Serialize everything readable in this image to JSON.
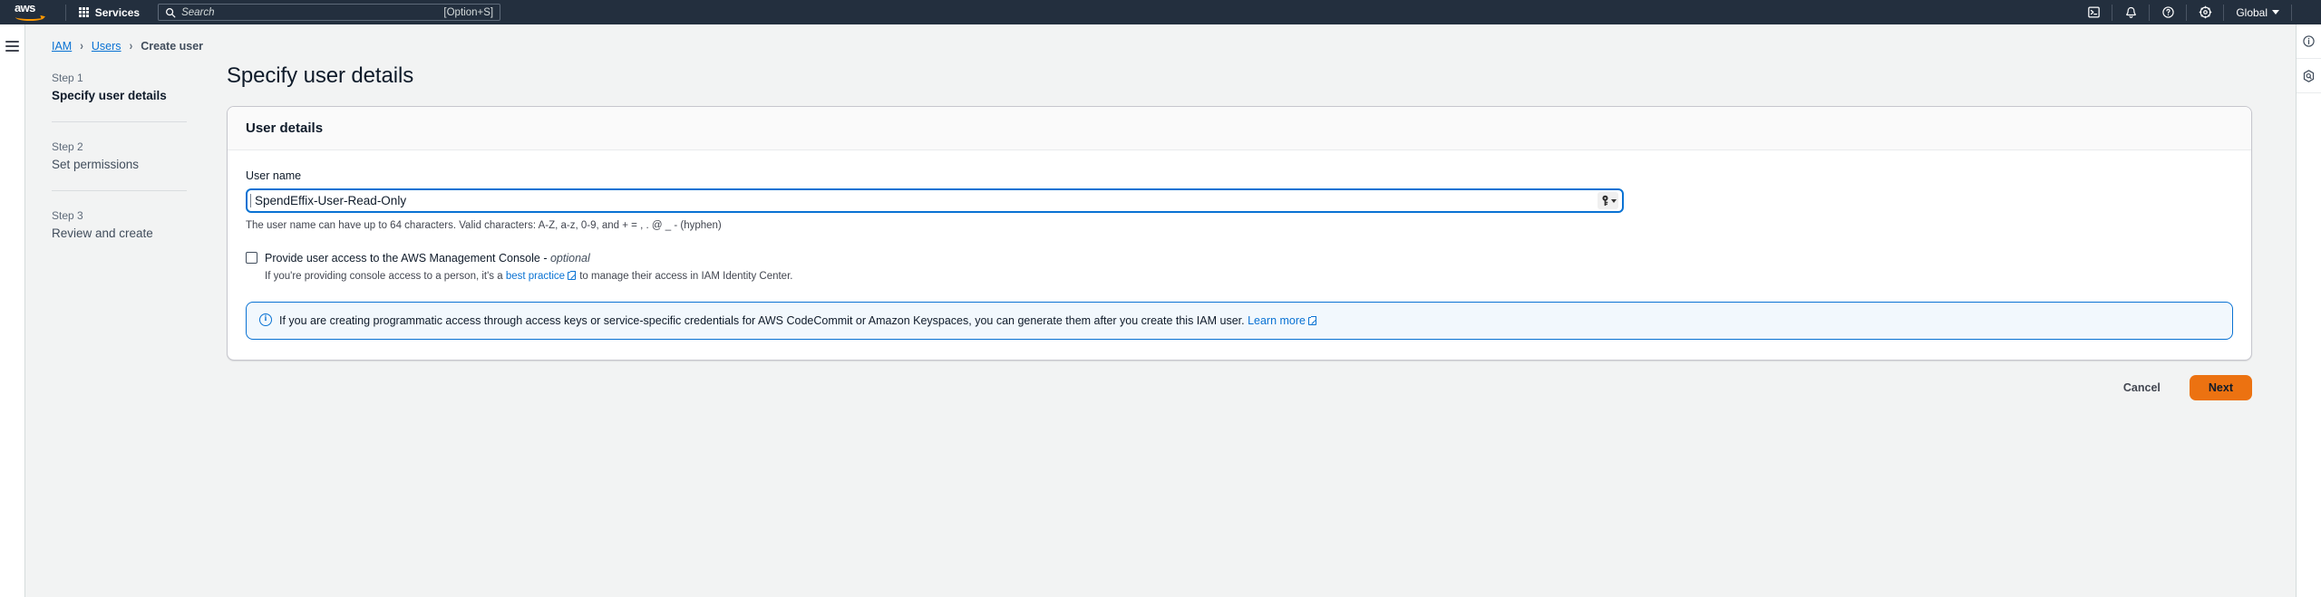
{
  "topnav": {
    "logo_alt": "aws",
    "services_label": "Services",
    "search": {
      "placeholder": "Search",
      "shortcut": "[Option+S]",
      "value": ""
    },
    "icons": {
      "cloudshell": "cloudshell-icon",
      "notifications": "bell-icon",
      "help": "help-icon",
      "settings": "gear-icon"
    },
    "region_label": "Global"
  },
  "breadcrumb": {
    "items": [
      {
        "label": "IAM",
        "link": true
      },
      {
        "label": "Users",
        "link": true
      },
      {
        "label": "Create user",
        "link": false
      }
    ],
    "separator": "›"
  },
  "wizard": {
    "steps": [
      {
        "num": "Step 1",
        "label": "Specify user details",
        "active": true
      },
      {
        "num": "Step 2",
        "label": "Set permissions",
        "active": false
      },
      {
        "num": "Step 3",
        "label": "Review and create",
        "active": false
      }
    ]
  },
  "page": {
    "title": "Specify user details"
  },
  "card": {
    "heading": "User details",
    "username": {
      "label": "User name",
      "value": "SpendEffix-User-Read-Only",
      "placeholder": "",
      "constraint": "The user name can have up to 64 characters. Valid characters: A-Z, a-z, 0-9, and + = , . @ _ - (hyphen)",
      "autofill_icon": "key-icon"
    },
    "console_access": {
      "checked": false,
      "label_main": "Provide user access to the AWS Management Console - ",
      "label_optional": "optional",
      "sub_prefix": "If you're providing console access to a person, it's a ",
      "sub_link": "best practice",
      "sub_suffix": " to manage their access in IAM Identity Center."
    },
    "alert": {
      "icon": "info-icon",
      "text": "If you are creating programmatic access through access keys or service-specific credentials for AWS CodeCommit or Amazon Keyspaces, you can generate them after you create this IAM user. ",
      "link": "Learn more"
    }
  },
  "actions": {
    "cancel_label": "Cancel",
    "next_label": "Next"
  },
  "right_rail": {
    "info_icon": "info-panel-icon",
    "assistant_icon": "amazon-q-icon"
  },
  "colors": {
    "nav_bg": "#232f3e",
    "accent_orange": "#ec7211",
    "link_blue": "#0972d3",
    "page_bg": "#f2f3f3"
  }
}
